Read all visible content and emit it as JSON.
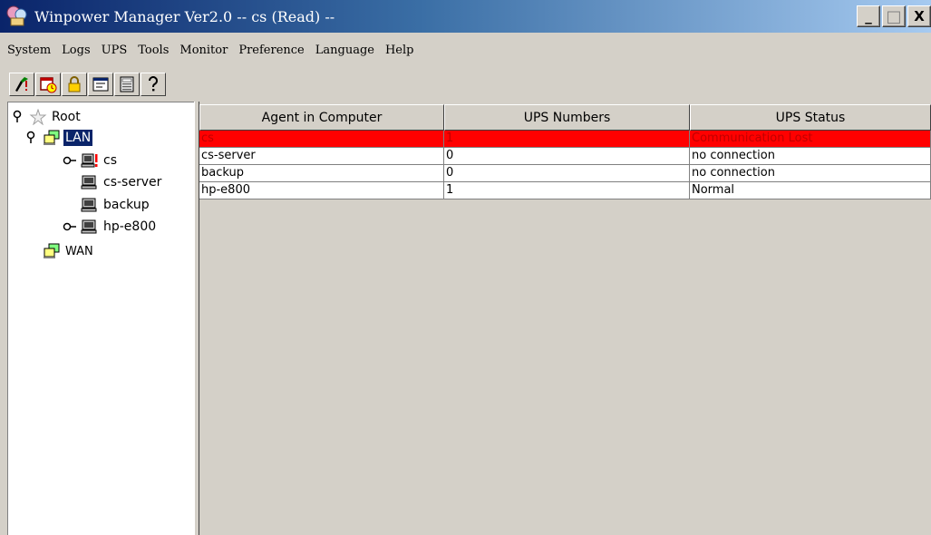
{
  "window": {
    "title": "Winpower Manager Ver2.0 -- cs (Read) --",
    "min_label": "_",
    "max_label": "□",
    "close_label": "X"
  },
  "menu": [
    "System",
    "Logs",
    "UPS",
    "Tools",
    "Monitor",
    "Preference",
    "Language",
    "Help"
  ],
  "toolbar": [
    "connect-icon",
    "calendar-icon",
    "lock-icon",
    "window-icon",
    "monitor-icon",
    "help-icon"
  ],
  "tree": {
    "root": "Root",
    "lan": "LAN",
    "cs": "cs",
    "cs_server": "cs-server",
    "backup": "backup",
    "hp_e800": "hp-e800",
    "wan": "WAN"
  },
  "table": {
    "headers": [
      "Agent in Computer",
      "UPS Numbers",
      "UPS Status"
    ],
    "rows": [
      {
        "agent": "cs",
        "numbers": "1",
        "status": "Communication Lost"
      },
      {
        "agent": "cs-server",
        "numbers": "0",
        "status": "no connection"
      },
      {
        "agent": "backup",
        "numbers": "0",
        "status": "no connection"
      },
      {
        "agent": "hp-e800",
        "numbers": "1",
        "status": "Normal"
      }
    ]
  },
  "colors": {
    "titlebar_start": "#0a246a",
    "titlebar_end": "#a6caf0",
    "alert_row": "#ff0000",
    "selection": "#0a246a"
  }
}
